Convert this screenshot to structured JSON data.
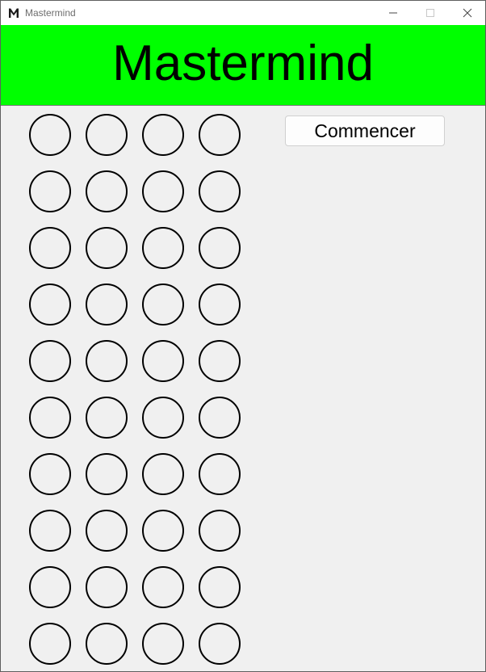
{
  "window": {
    "title": "Mastermind",
    "icon": "mastermind-m-icon"
  },
  "window_controls": {
    "minimize_icon": "minimize-icon",
    "maximize_icon": "maximize-icon",
    "close_icon": "close-icon"
  },
  "banner": {
    "title": "Mastermind",
    "background_color": "#00ff00"
  },
  "board": {
    "rows": 10,
    "pegs_per_row": 4,
    "peg_state": "empty"
  },
  "actions": {
    "start_label": "Commencer"
  }
}
